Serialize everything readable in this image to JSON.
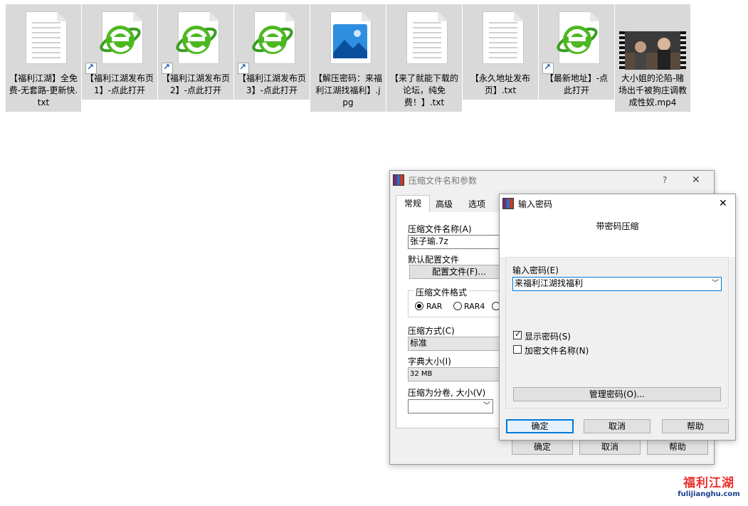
{
  "desktop": {
    "files": [
      {
        "label": "【福利江湖】全免费-无套路-更新快.txt",
        "type": "txt",
        "shortcut": false
      },
      {
        "label": "【福利江湖发布页1】-点此打开",
        "type": "ie",
        "shortcut": true
      },
      {
        "label": "【福利江湖发布页2】-点此打开",
        "type": "ie",
        "shortcut": true
      },
      {
        "label": "【福利江湖发布页3】-点此打开",
        "type": "ie",
        "shortcut": true
      },
      {
        "label": "【解压密码：来福利江湖找福利】.jpg",
        "type": "jpg",
        "shortcut": false
      },
      {
        "label": "【来了就能下载的论坛，纯免费！】.txt",
        "type": "txt",
        "shortcut": false
      },
      {
        "label": "【永久地址发布页】.txt",
        "type": "txt",
        "shortcut": false
      },
      {
        "label": "【最新地址】-点此打开",
        "type": "ie",
        "shortcut": true
      },
      {
        "label": "大小姐的沦陷-赌场出千被狗庄调教成性奴.mp4",
        "type": "mp4",
        "shortcut": false
      }
    ]
  },
  "archive_dialog": {
    "title": "压缩文件名和参数",
    "help": "?",
    "close": "✕",
    "tabs": [
      "常规",
      "高级",
      "选项"
    ],
    "archive_name_label": "压缩文件名称(A)",
    "archive_name_value": "张子瑜.7z",
    "profile_label": "默认配置文件",
    "profile_button": "配置文件(F)...",
    "format_group": "压缩文件格式",
    "format_options": [
      "RAR",
      "RAR4"
    ],
    "method_label": "压缩方式(C)",
    "method_value": "标准",
    "dict_label": "字典大小(I)",
    "dict_value": "32 MB",
    "split_label": "压缩为分卷, 大小(V)",
    "ok": "确定",
    "cancel": "取消",
    "help_btn": "帮助"
  },
  "password_dialog": {
    "title": "输入密码",
    "close": "✕",
    "heading": "带密码压缩",
    "password_label": "输入密码(E)",
    "password_value": "来福利江湖找福利",
    "show_password": "显示密码(S)",
    "show_password_checked": true,
    "encrypt_names": "加密文件名称(N)",
    "encrypt_names_checked": false,
    "manage_button": "管理密码(O)...",
    "ok": "确定",
    "cancel": "取消",
    "help_btn": "帮助"
  },
  "watermark": {
    "text": "福利江湖",
    "url": "fulijianghu.com"
  }
}
